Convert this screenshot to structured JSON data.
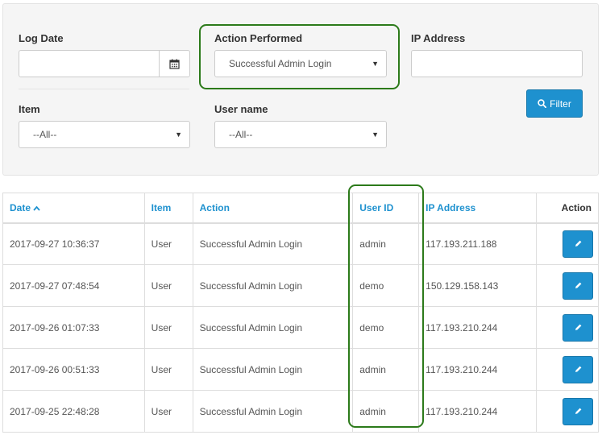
{
  "filters": {
    "log_date": {
      "label": "Log Date",
      "value": ""
    },
    "action_performed": {
      "label": "Action Performed",
      "value": "Successful Admin Login"
    },
    "ip_address": {
      "label": "IP Address",
      "value": ""
    },
    "item": {
      "label": "Item",
      "value": "--All--"
    },
    "user_name": {
      "label": "User name",
      "value": "--All--"
    },
    "filter_button": "Filter"
  },
  "table": {
    "headers": {
      "date": "Date",
      "item": "Item",
      "action": "Action",
      "user_id": "User ID",
      "ip_address": "IP Address",
      "action_col": "Action"
    },
    "rows": [
      {
        "date": "2017-09-27 10:36:37",
        "item": "User",
        "action": "Successful Admin Login",
        "user_id": "admin",
        "ip": "117.193.211.188"
      },
      {
        "date": "2017-09-27 07:48:54",
        "item": "User",
        "action": "Successful Admin Login",
        "user_id": "demo",
        "ip": "150.129.158.143"
      },
      {
        "date": "2017-09-26 01:07:33",
        "item": "User",
        "action": "Successful Admin Login",
        "user_id": "demo",
        "ip": "117.193.210.244"
      },
      {
        "date": "2017-09-26 00:51:33",
        "item": "User",
        "action": "Successful Admin Login",
        "user_id": "admin",
        "ip": "117.193.210.244"
      },
      {
        "date": "2017-09-25 22:48:28",
        "item": "User",
        "action": "Successful Admin Login",
        "user_id": "admin",
        "ip": "117.193.210.244"
      }
    ]
  },
  "icons": {
    "calendar": "calendar-icon",
    "search": "search-icon",
    "edit": "pencil-icon",
    "sort": "caret-up-icon",
    "dropdown": "caret-down-icon"
  },
  "colors": {
    "primary": "#1e91cf",
    "highlight": "#2c7a1a"
  }
}
